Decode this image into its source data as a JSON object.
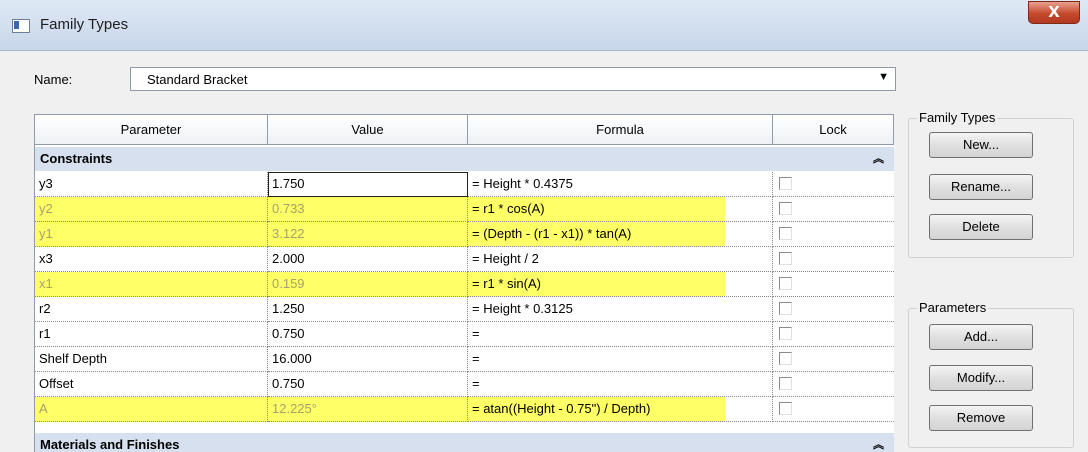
{
  "window": {
    "title": "Family Types",
    "close_label": "X"
  },
  "name_field": {
    "label": "Name:",
    "value": "Standard Bracket"
  },
  "table": {
    "columns": [
      "Parameter",
      "Value",
      "Formula",
      "Lock"
    ],
    "groups": [
      {
        "label": "Constraints",
        "rows": [
          {
            "parameter": "y3",
            "value": "1.750",
            "formula": "= Height * 0.4375",
            "highlighted": false
          },
          {
            "parameter": "y2",
            "value": "0.733",
            "formula": "= r1 * cos(A)",
            "highlighted": true
          },
          {
            "parameter": "y1",
            "value": "3.122",
            "formula": "= (Depth - (r1 - x1)) * tan(A)",
            "highlighted": true
          },
          {
            "parameter": "x3",
            "value": "2.000",
            "formula": "= Height / 2",
            "highlighted": false
          },
          {
            "parameter": "x1",
            "value": "0.159",
            "formula": "= r1 * sin(A)",
            "highlighted": true
          },
          {
            "parameter": "r2",
            "value": "1.250",
            "formula": "= Height * 0.3125",
            "highlighted": false
          },
          {
            "parameter": "r1",
            "value": "0.750",
            "formula": "=",
            "highlighted": false
          },
          {
            "parameter": "Shelf Depth",
            "value": "16.000",
            "formula": "=",
            "highlighted": false
          },
          {
            "parameter": "Offset",
            "value": "0.750",
            "formula": "=",
            "highlighted": false
          },
          {
            "parameter": "A",
            "value": "12.225°",
            "formula": "= atan((Height - 0.75\") / Depth)",
            "highlighted": true
          }
        ]
      },
      {
        "label": "Materials and Finishes",
        "rows": []
      }
    ]
  },
  "family_types_panel": {
    "legend": "Family Types",
    "buttons": [
      "New...",
      "Rename...",
      "Delete"
    ]
  },
  "parameters_panel": {
    "legend": "Parameters",
    "buttons": [
      "Add...",
      "Modify...",
      "Remove"
    ]
  },
  "colors": {
    "highlight": "#ffff66",
    "group_header": "#d6e0ee"
  }
}
